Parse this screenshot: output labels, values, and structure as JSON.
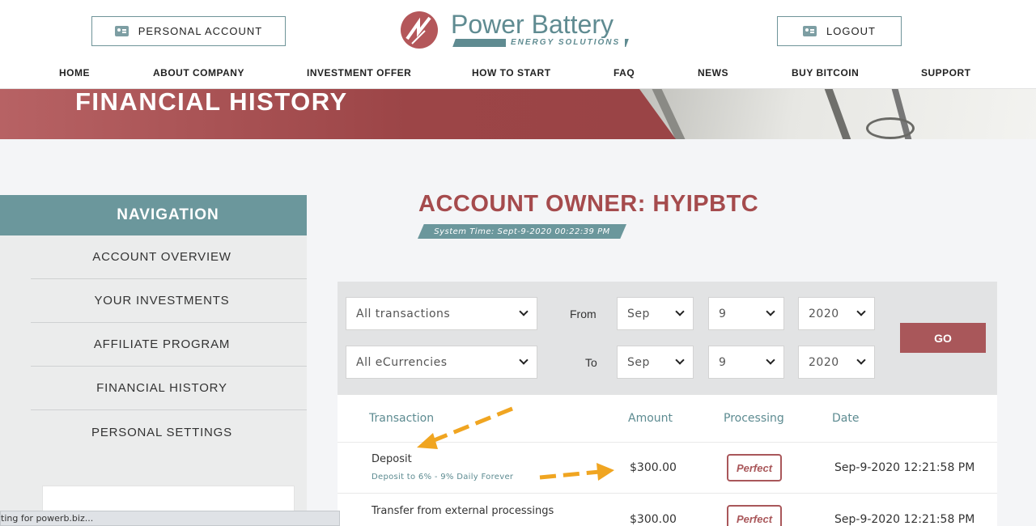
{
  "header": {
    "personal_account": "PERSONAL ACCOUNT",
    "logout": "LOGOUT",
    "logo_name": "Power Battery",
    "logo_sub": "ENERGY SOLUTIONS",
    "menu": [
      "HOME",
      "ABOUT COMPANY",
      "INVESTMENT OFFER",
      "HOW TO START",
      "FAQ",
      "NEWS",
      "BUY BITCOIN",
      "SUPPORT"
    ]
  },
  "banner": {
    "title": "FINANCIAL HISTORY"
  },
  "sidebar": {
    "title": "NAVIGATION",
    "items": [
      "ACCOUNT OVERVIEW",
      "YOUR INVESTMENTS",
      "AFFILIATE PROGRAM",
      "FINANCIAL HISTORY",
      "PERSONAL SETTINGS"
    ]
  },
  "main": {
    "owner": "ACCOUNT OWNER: HYIPBTC",
    "system_time": "System Time: Sept-9-2020 00:22:39 PM"
  },
  "filters": {
    "type": "All transactions",
    "currency": "All eCurrencies",
    "from_label": "From",
    "to_label": "To",
    "from": {
      "month": "Sep",
      "day": "9",
      "year": "2020"
    },
    "to": {
      "month": "Sep",
      "day": "9",
      "year": "2020"
    },
    "go": "GO"
  },
  "table": {
    "headers": [
      "Transaction",
      "Amount",
      "Processing",
      "Date"
    ],
    "rows": [
      {
        "title": "Deposit",
        "sub": "Deposit to 6% - 9% Daily Forever",
        "amount": "$300.00",
        "processing": "Perfect",
        "date": "Sep-9-2020 12:21:58 PM"
      },
      {
        "title": "Transfer from external processings",
        "sub": "",
        "amount": "$300.00",
        "processing": "Perfect",
        "date": "Sep-9-2020 12:21:58 PM"
      }
    ]
  },
  "status_bar": "ting for powerb.biz...",
  "colors": {
    "accent_red": "#a9575a",
    "accent_teal": "#6b979c"
  }
}
